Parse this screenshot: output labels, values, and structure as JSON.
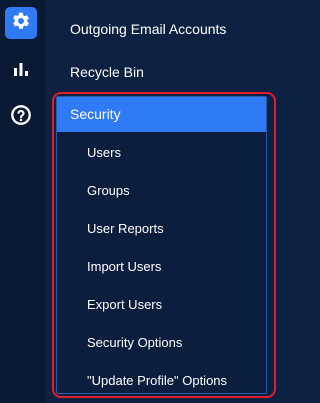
{
  "rail": {
    "items": [
      {
        "icon": "gear-icon",
        "active": true
      },
      {
        "icon": "bar-chart-icon",
        "active": false
      },
      {
        "icon": "help-circle-icon",
        "active": false
      }
    ]
  },
  "menu": {
    "items": [
      {
        "label": "Outgoing Email Accounts"
      },
      {
        "label": "Recycle Bin"
      }
    ],
    "security": {
      "label": "Security",
      "items": [
        {
          "label": "Users"
        },
        {
          "label": "Groups"
        },
        {
          "label": "User Reports"
        },
        {
          "label": "Import Users"
        },
        {
          "label": "Export Users"
        },
        {
          "label": "Security Options"
        },
        {
          "label": "\"Update Profile\" Options"
        }
      ]
    }
  },
  "colors": {
    "sidebar_bg": "#0c2141",
    "rail_bg": "#0a1a35",
    "accent": "#2f7bf5",
    "highlight_border": "#e3202a"
  }
}
